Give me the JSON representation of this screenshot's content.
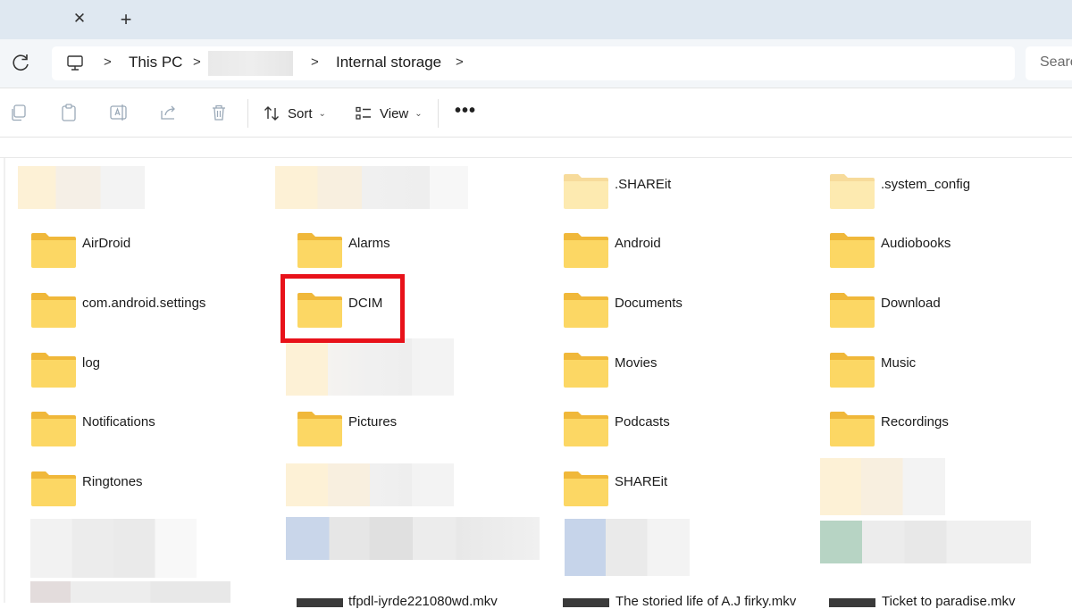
{
  "window": {
    "new_tab_glyph": "+",
    "close_tab_glyph": "✕"
  },
  "address_bar": {
    "breadcrumbs": [
      "This PC",
      "Internal storage"
    ],
    "separator_glyph": ">",
    "search_placeholder": "Search"
  },
  "toolbar": {
    "sort_label": "Sort",
    "view_label": "View",
    "more_glyph": "•••",
    "icons": [
      "copy-icon",
      "paste-icon",
      "rename-icon",
      "share-icon",
      "delete-icon",
      "sort-icon",
      "view-icon"
    ]
  },
  "folders": [
    {
      "name": ".SHAREit",
      "faded": true
    },
    {
      "name": ".system_config",
      "faded": true
    },
    {
      "name": "AirDroid"
    },
    {
      "name": "Alarms"
    },
    {
      "name": "Android"
    },
    {
      "name": "Audiobooks"
    },
    {
      "name": "com.android.settings"
    },
    {
      "name": "DCIM",
      "highlighted": true
    },
    {
      "name": "Documents"
    },
    {
      "name": "Download"
    },
    {
      "name": "log"
    },
    {
      "name": "Movies"
    },
    {
      "name": "Music"
    },
    {
      "name": "Notifications"
    },
    {
      "name": "Pictures"
    },
    {
      "name": "Podcasts"
    },
    {
      "name": "Recordings"
    },
    {
      "name": "Ringtones"
    },
    {
      "name": "SHAREit"
    }
  ],
  "files": [
    {
      "name": "tfpdl-iyrde221080wd.mkv"
    },
    {
      "name": "The storied life of A.J firky.mkv"
    },
    {
      "name": "Ticket to paradise.mkv"
    }
  ],
  "colors": {
    "folder_front": "#fcd764",
    "folder_back": "#f0b83a",
    "highlight_border": "#e8121a",
    "tabbar_bg": "#dfe8f1"
  }
}
